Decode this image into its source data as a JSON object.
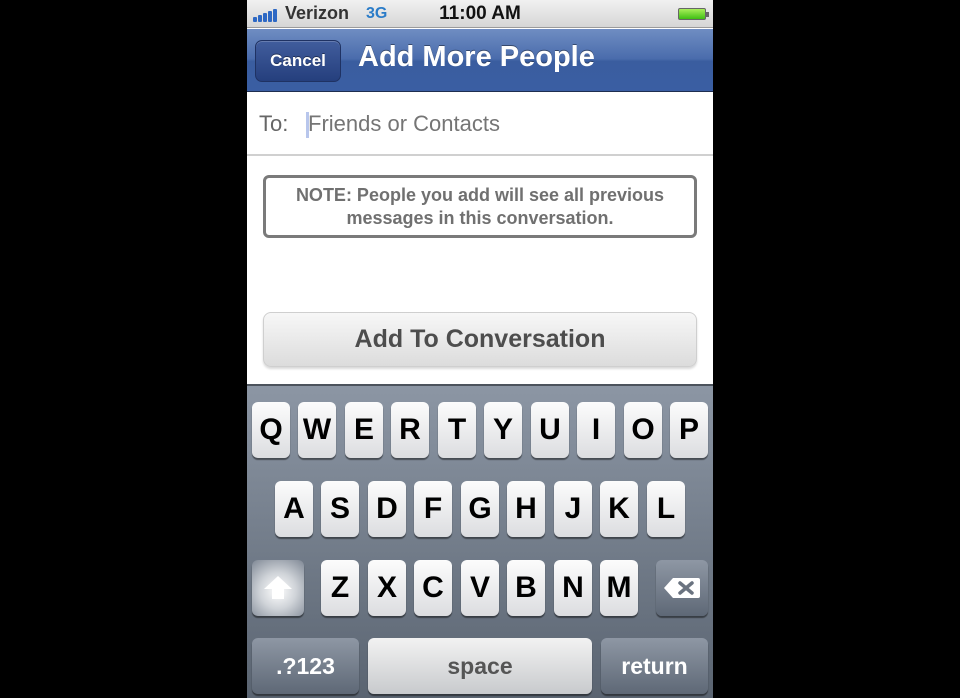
{
  "status_bar": {
    "carrier": "Verizon",
    "network": "3G",
    "time": "11:00 AM",
    "signal_bars": 5,
    "battery_level": "full",
    "network_color": "#2b7cc8"
  },
  "nav_bar": {
    "cancel_label": "Cancel",
    "title": "Add More People",
    "color": "#4a6cac"
  },
  "to_field": {
    "label": "To:",
    "value": "",
    "placeholder": "Friends or Contacts"
  },
  "note": {
    "line1": "NOTE: People you add will see all previous",
    "line2": "messages in this conversation."
  },
  "add_button": {
    "label": "Add To Conversation"
  },
  "keyboard": {
    "row1": [
      "Q",
      "W",
      "E",
      "R",
      "T",
      "Y",
      "U",
      "I",
      "O",
      "P"
    ],
    "row2": [
      "A",
      "S",
      "D",
      "F",
      "G",
      "H",
      "J",
      "K",
      "L"
    ],
    "row3": [
      "Z",
      "X",
      "C",
      "V",
      "B",
      "N",
      "M"
    ],
    "shift_icon": "shift-arrow-icon",
    "delete_icon": "backspace-icon",
    "numbers_label": ".?123",
    "space_label": "space",
    "return_label": "return"
  }
}
